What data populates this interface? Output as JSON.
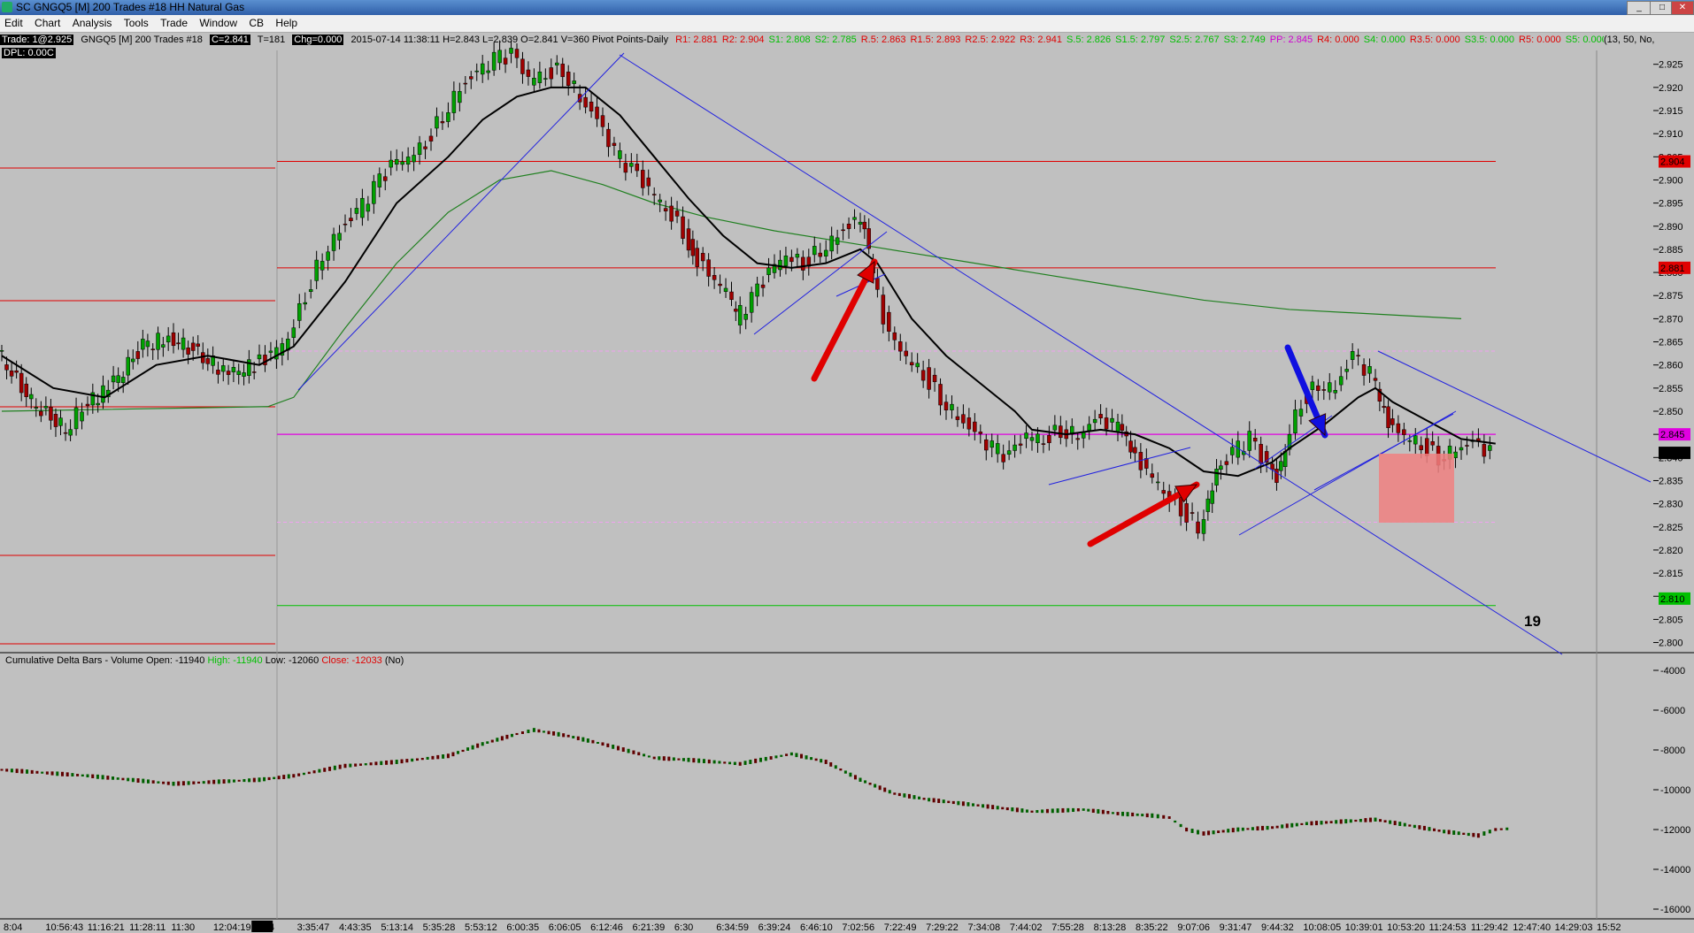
{
  "window": {
    "title": "SC GNGQ5 [M]  200 Trades  #18  HH Natural Gas",
    "min_label": "_",
    "max_label": "□",
    "close_label": "✕"
  },
  "menu": [
    "Edit",
    "Chart",
    "Analysis",
    "Tools",
    "Trade",
    "Window",
    "CB",
    "Help"
  ],
  "infobar": {
    "trade": "Trade: 1@2.925",
    "symbol": "GNGQ5 [M]  200 Trades  #18",
    "close": "C=2.841",
    "ticks": "T=181",
    "change": "Chg=0.000",
    "bar": "2015-07-14 11:38:11 H=2.843 L=2.839 O=2.841 V=360 Pivot Points-Daily",
    "pivots": [
      {
        "text": "R1: 2.881",
        "color": "#e00000"
      },
      {
        "text": "R2: 2.904",
        "color": "#e00000"
      },
      {
        "text": "S1: 2.808",
        "color": "#00c000"
      },
      {
        "text": "S2: 2.785",
        "color": "#00c000"
      },
      {
        "text": "R.5: 2.863",
        "color": "#e00000"
      },
      {
        "text": "R1.5: 2.893",
        "color": "#e00000"
      },
      {
        "text": "R2.5: 2.922",
        "color": "#e00000"
      },
      {
        "text": "R3: 2.941",
        "color": "#e00000"
      },
      {
        "text": "S.5: 2.826",
        "color": "#00c000"
      },
      {
        "text": "S1.5: 2.797",
        "color": "#00c000"
      },
      {
        "text": "S2.5: 2.767",
        "color": "#00c000"
      },
      {
        "text": "S3: 2.749",
        "color": "#00c000"
      },
      {
        "text": "PP: 2.845",
        "color": "#d000d0"
      },
      {
        "text": "R4: 0.000",
        "color": "#e00000"
      },
      {
        "text": "S4: 0.000",
        "color": "#00c000"
      },
      {
        "text": "R3.5: 0.000",
        "color": "#e00000"
      },
      {
        "text": "S3.5: 0.000",
        "color": "#00c000"
      },
      {
        "text": "R5: 0.000",
        "color": "#e00000"
      },
      {
        "text": "S5: 0.000",
        "color": "#00c000"
      }
    ],
    "params": "(13, 50, No,"
  },
  "dpl": "DPL: 0.00C",
  "price_axis": {
    "ticks": [
      "2.925",
      "2.920",
      "2.915",
      "2.910",
      "2.905",
      "2.900",
      "2.895",
      "2.890",
      "2.885",
      "2.880",
      "2.875",
      "2.870",
      "2.865",
      "2.860",
      "2.855",
      "2.850",
      "2.845",
      "2.840",
      "2.835",
      "2.830",
      "2.825",
      "2.820",
      "2.815",
      "2.810",
      "2.805",
      "2.800"
    ],
    "min": 2.798,
    "max": 2.928,
    "markers": [
      {
        "label": "2.904",
        "value": 2.904,
        "color": "#e00000",
        "text_color": "#fff"
      },
      {
        "label": "2.881",
        "value": 2.881,
        "color": "#e00000",
        "text_color": "#fff"
      },
      {
        "label": "2.845",
        "value": 2.845,
        "color": "#e000e0",
        "text_color": "#fff"
      },
      {
        "label": "2.841",
        "value": 2.841,
        "color": "#000",
        "text_color": "#fff"
      },
      {
        "label": "2.810",
        "value": 2.8095,
        "color": "#00c000",
        "text_color": "#fff"
      }
    ]
  },
  "annotation": "19",
  "subpanel": {
    "title": "Cumulative Delta Bars - Volume",
    "open": "Open: -11940",
    "high": "High: -11940",
    "low": "Low: -12060",
    "close": "Close: -12033",
    "flag": "(No)",
    "ticks": [
      "-4000",
      "-6000",
      "-8000",
      "-10000",
      "-12000",
      "-14000",
      "-16000"
    ],
    "min": -16000,
    "max": -4000
  },
  "time_axis": {
    "ticks": [
      "8:04",
      "10:56:43",
      "11:16:21",
      "11:28:11",
      "11:30",
      "12:04:19",
      "7-14",
      "3:35:47",
      "4:43:35",
      "5:13:14",
      "5:35:28",
      "5:53:12",
      "6:00:35",
      "6:06:05",
      "6:12:46",
      "6:21:39",
      "6:30",
      "6:34:59",
      "6:39:24",
      "6:46:10",
      "7:02:56",
      "7:22:49",
      "7:29:22",
      "7:34:08",
      "7:44:02",
      "7:55:28",
      "8:13:28",
      "8:35:22",
      "9:07:06",
      "9:31:47",
      "9:44:32",
      "10:08:05",
      "10:39:01",
      "10:53:20",
      "11:24:53",
      "11:29:42",
      "12:47:40",
      "14:29:03",
      "15:52"
    ],
    "highlight": "7-14"
  },
  "chart_data": {
    "type": "candlestick",
    "instrument": "GNGQ5",
    "price_points": [
      [
        0,
        2.863
      ],
      [
        40,
        2.852
      ],
      [
        80,
        2.846
      ],
      [
        100,
        2.851
      ],
      [
        130,
        2.855
      ],
      [
        170,
        2.864
      ],
      [
        200,
        2.866
      ],
      [
        240,
        2.862
      ],
      [
        270,
        2.858
      ],
      [
        300,
        2.86
      ],
      [
        320,
        2.862
      ],
      [
        340,
        2.866
      ],
      [
        360,
        2.875
      ],
      [
        380,
        2.884
      ],
      [
        400,
        2.889
      ],
      [
        420,
        2.893
      ],
      [
        440,
        2.898
      ],
      [
        460,
        2.903
      ],
      [
        480,
        2.905
      ],
      [
        500,
        2.908
      ],
      [
        520,
        2.914
      ],
      [
        540,
        2.92
      ],
      [
        560,
        2.923
      ],
      [
        580,
        2.926
      ],
      [
        600,
        2.927
      ],
      [
        620,
        2.922
      ],
      [
        640,
        2.923
      ],
      [
        660,
        2.924
      ],
      [
        680,
        2.918
      ],
      [
        700,
        2.913
      ],
      [
        720,
        2.906
      ],
      [
        740,
        2.902
      ],
      [
        760,
        2.898
      ],
      [
        780,
        2.894
      ],
      [
        800,
        2.889
      ],
      [
        810,
        2.884
      ],
      [
        830,
        2.88
      ],
      [
        850,
        2.876
      ],
      [
        860,
        2.87
      ],
      [
        880,
        2.874
      ],
      [
        900,
        2.88
      ],
      [
        920,
        2.884
      ],
      [
        940,
        2.882
      ],
      [
        960,
        2.885
      ],
      [
        980,
        2.888
      ],
      [
        1000,
        2.891
      ],
      [
        1010,
        2.888
      ],
      [
        1020,
        2.879
      ],
      [
        1040,
        2.866
      ],
      [
        1060,
        2.862
      ],
      [
        1080,
        2.858
      ],
      [
        1100,
        2.853
      ],
      [
        1120,
        2.849
      ],
      [
        1140,
        2.845
      ],
      [
        1160,
        2.842
      ],
      [
        1180,
        2.84
      ],
      [
        1200,
        2.845
      ],
      [
        1220,
        2.844
      ],
      [
        1240,
        2.846
      ],
      [
        1260,
        2.845
      ],
      [
        1280,
        2.848
      ],
      [
        1300,
        2.847
      ],
      [
        1310,
        2.845
      ],
      [
        1320,
        2.841
      ],
      [
        1340,
        2.837
      ],
      [
        1360,
        2.833
      ],
      [
        1380,
        2.829
      ],
      [
        1400,
        2.825
      ],
      [
        1410,
        2.83
      ],
      [
        1420,
        2.836
      ],
      [
        1440,
        2.841
      ],
      [
        1460,
        2.844
      ],
      [
        1480,
        2.838
      ],
      [
        1490,
        2.836
      ],
      [
        1500,
        2.843
      ],
      [
        1520,
        2.852
      ],
      [
        1540,
        2.856
      ],
      [
        1560,
        2.855
      ],
      [
        1580,
        2.862
      ],
      [
        1600,
        2.858
      ],
      [
        1610,
        2.852
      ],
      [
        1620,
        2.847
      ],
      [
        1640,
        2.845
      ],
      [
        1660,
        2.843
      ],
      [
        1680,
        2.84
      ],
      [
        1700,
        2.842
      ],
      [
        1720,
        2.843
      ],
      [
        1740,
        2.841
      ]
    ],
    "ema_fast_points": [
      [
        0,
        2.862
      ],
      [
        60,
        2.855
      ],
      [
        120,
        2.853
      ],
      [
        180,
        2.86
      ],
      [
        240,
        2.862
      ],
      [
        300,
        2.86
      ],
      [
        340,
        2.864
      ],
      [
        400,
        2.878
      ],
      [
        460,
        2.895
      ],
      [
        520,
        2.905
      ],
      [
        560,
        2.913
      ],
      [
        600,
        2.918
      ],
      [
        640,
        2.92
      ],
      [
        680,
        2.92
      ],
      [
        720,
        2.914
      ],
      [
        760,
        2.905
      ],
      [
        800,
        2.896
      ],
      [
        840,
        2.888
      ],
      [
        880,
        2.882
      ],
      [
        920,
        2.881
      ],
      [
        960,
        2.882
      ],
      [
        1000,
        2.885
      ],
      [
        1020,
        2.882
      ],
      [
        1060,
        2.87
      ],
      [
        1100,
        2.862
      ],
      [
        1140,
        2.856
      ],
      [
        1180,
        2.85
      ],
      [
        1200,
        2.846
      ],
      [
        1240,
        2.845
      ],
      [
        1280,
        2.846
      ],
      [
        1320,
        2.845
      ],
      [
        1360,
        2.842
      ],
      [
        1400,
        2.837
      ],
      [
        1440,
        2.836
      ],
      [
        1480,
        2.839
      ],
      [
        1500,
        2.842
      ],
      [
        1540,
        2.847
      ],
      [
        1580,
        2.853
      ],
      [
        1600,
        2.855
      ],
      [
        1620,
        2.852
      ],
      [
        1660,
        2.848
      ],
      [
        1700,
        2.844
      ],
      [
        1740,
        2.843
      ]
    ],
    "ema_slow_points": [
      [
        0,
        2.85
      ],
      [
        310,
        2.851
      ],
      [
        340,
        2.853
      ],
      [
        400,
        2.868
      ],
      [
        460,
        2.882
      ],
      [
        520,
        2.893
      ],
      [
        580,
        2.9
      ],
      [
        640,
        2.902
      ],
      [
        700,
        2.899
      ],
      [
        760,
        2.895
      ],
      [
        820,
        2.892
      ],
      [
        900,
        2.889
      ],
      [
        1000,
        2.886
      ],
      [
        1100,
        2.883
      ],
      [
        1200,
        2.88
      ],
      [
        1300,
        2.877
      ],
      [
        1400,
        2.874
      ],
      [
        1500,
        2.872
      ],
      [
        1600,
        2.871
      ],
      [
        1700,
        2.87
      ]
    ],
    "pivot_levels": {
      "R2": 2.904,
      "R1": 2.881,
      "R.5": 2.863,
      "PP": 2.845,
      "S.5": 2.826,
      "S1": 2.808,
      "S2": 2.785
    },
    "delta_points": [
      [
        0,
        -9000
      ],
      [
        100,
        -9300
      ],
      [
        200,
        -9700
      ],
      [
        300,
        -9500
      ],
      [
        340,
        -9300
      ],
      [
        400,
        -8800
      ],
      [
        460,
        -8600
      ],
      [
        520,
        -8300
      ],
      [
        560,
        -7700
      ],
      [
        600,
        -7200
      ],
      [
        620,
        -7000
      ],
      [
        660,
        -7300
      ],
      [
        700,
        -7700
      ],
      [
        760,
        -8400
      ],
      [
        800,
        -8500
      ],
      [
        860,
        -8700
      ],
      [
        920,
        -8200
      ],
      [
        960,
        -8600
      ],
      [
        1000,
        -9500
      ],
      [
        1040,
        -10200
      ],
      [
        1080,
        -10500
      ],
      [
        1120,
        -10700
      ],
      [
        1160,
        -10900
      ],
      [
        1200,
        -11100
      ],
      [
        1260,
        -11000
      ],
      [
        1300,
        -11200
      ],
      [
        1340,
        -11300
      ],
      [
        1360,
        -11400
      ],
      [
        1380,
        -12000
      ],
      [
        1400,
        -12200
      ],
      [
        1440,
        -12000
      ],
      [
        1480,
        -11900
      ],
      [
        1520,
        -11700
      ],
      [
        1560,
        -11600
      ],
      [
        1600,
        -11500
      ],
      [
        1640,
        -11800
      ],
      [
        1680,
        -12100
      ],
      [
        1720,
        -12300
      ],
      [
        1740,
        -12000
      ],
      [
        1760,
        -11950
      ]
    ]
  },
  "colors": {
    "background": "#c0c0c0",
    "up_candle": "#00a000",
    "down_candle": "#a00000",
    "trendline": "#2020e0",
    "ema_fast": "#000000",
    "ema_slow": "#208020",
    "resistance": "#e00000",
    "support": "#00c000",
    "pivot": "#e000e0",
    "arrow_red": "#e00000",
    "arrow_blue": "#1010e0",
    "zone": "#f08080"
  }
}
